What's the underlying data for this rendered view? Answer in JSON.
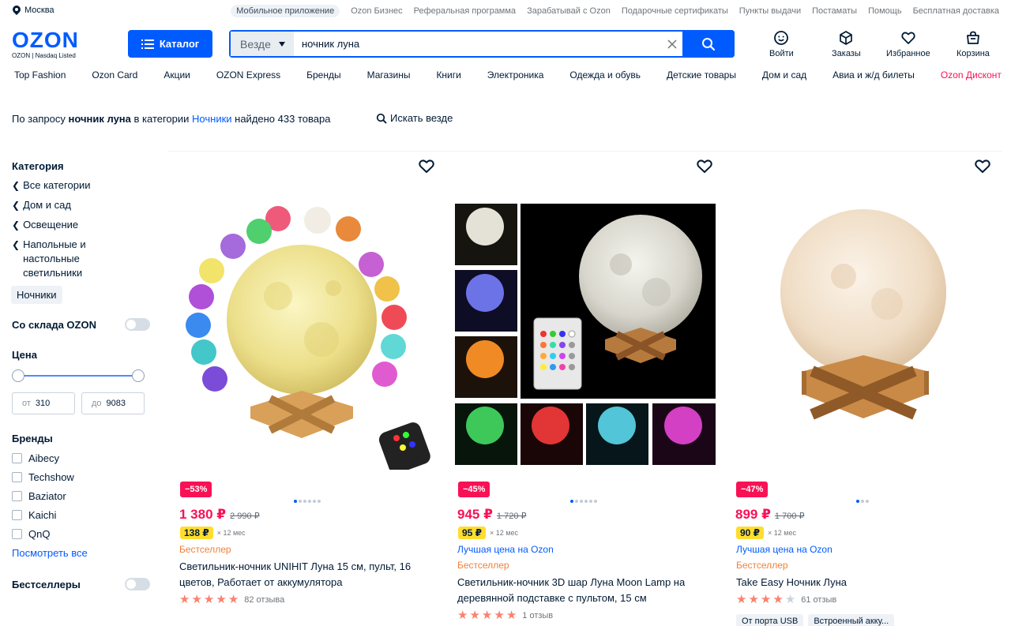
{
  "topbar": {
    "city": "Москва",
    "links": [
      "Мобильное приложение",
      "Ozon Бизнес",
      "Реферальная программа",
      "Зарабатывай с Ozon",
      "Подарочные сертификаты",
      "Пункты выдачи",
      "Постаматы",
      "Помощь",
      "Бесплатная доставка"
    ]
  },
  "header": {
    "logo": "OZON",
    "logo_sub": "OZON | Nasdaq Listed",
    "catalog": "Каталог",
    "search_scope": "Везде",
    "search_value": "ночник луна",
    "icons": [
      {
        "name": "login",
        "label": "Войти"
      },
      {
        "name": "orders",
        "label": "Заказы"
      },
      {
        "name": "favorites",
        "label": "Избранное"
      },
      {
        "name": "cart",
        "label": "Корзина"
      }
    ]
  },
  "nav": [
    "Top Fashion",
    "Ozon Card",
    "Акции",
    "OZON Express",
    "Бренды",
    "Магазины",
    "Книги",
    "Электроника",
    "Одежда и обувь",
    "Детские товары",
    "Дом и сад",
    "Авиа и ж/д билеты",
    "Ozon Дисконт"
  ],
  "summary": {
    "prefix": "По запросу ",
    "query": "ночник луна",
    "middle": " в категории ",
    "category": "Ночники",
    "suffix": " найдено 433 товара",
    "search_everywhere": "Искать везде"
  },
  "sidebar": {
    "category_title": "Категория",
    "categories": [
      "Все категории",
      "Дом и сад",
      "Освещение",
      "Напольные и настольные светильники"
    ],
    "current": "Ночники",
    "warehouse": "Со склада OZON",
    "price_title": "Цена",
    "price_from_label": "от",
    "price_from": "310",
    "price_to_label": "до",
    "price_to": "9083",
    "brands_title": "Бренды",
    "brands": [
      "Aibecy",
      "Techshow",
      "Baziator",
      "Kaichi",
      "QnQ"
    ],
    "see_all": "Посмотреть все",
    "bestsellers": "Бестселлеры"
  },
  "products": [
    {
      "discount": "−53%",
      "price": "1 380 ₽",
      "old_price": "2 990 ₽",
      "installment": "138 ₽",
      "installment_term": "× 12 мес",
      "tag_blue": "",
      "tag_orange": "Бестселлер",
      "title": "Светильник-ночник UNIHIT Луна 15 см, пульт, 16 цветов, Работает от аккумулятора",
      "rating": 4.5,
      "reviews": "82 отзыва"
    },
    {
      "discount": "−45%",
      "price": "945 ₽",
      "old_price": "1 720 ₽",
      "installment": "95 ₽",
      "installment_term": "× 12 мес",
      "tag_blue": "Лучшая цена на Ozon",
      "tag_orange": "Бестселлер",
      "title": "Светильник-ночник 3D шар Луна Moon Lamp на деревянной подставке с пультом, 15 см",
      "rating": 5,
      "reviews": "1 отзыв"
    },
    {
      "discount": "−47%",
      "price": "899 ₽",
      "old_price": "1 700 ₽",
      "installment": "90 ₽",
      "installment_term": "× 12 мес",
      "tag_blue": "Лучшая цена на Ozon",
      "tag_orange": "Бестселлер",
      "title": "Take Easy Ночник Луна",
      "rating": 3.5,
      "reviews": "61 отзыв",
      "features": [
        "От порта USB",
        "Встроенный акку..."
      ]
    }
  ],
  "colors": {
    "brand": "#005bff",
    "sale": "#f91155",
    "installment": "#ffdd2d",
    "bestseller": "#f1803a"
  }
}
